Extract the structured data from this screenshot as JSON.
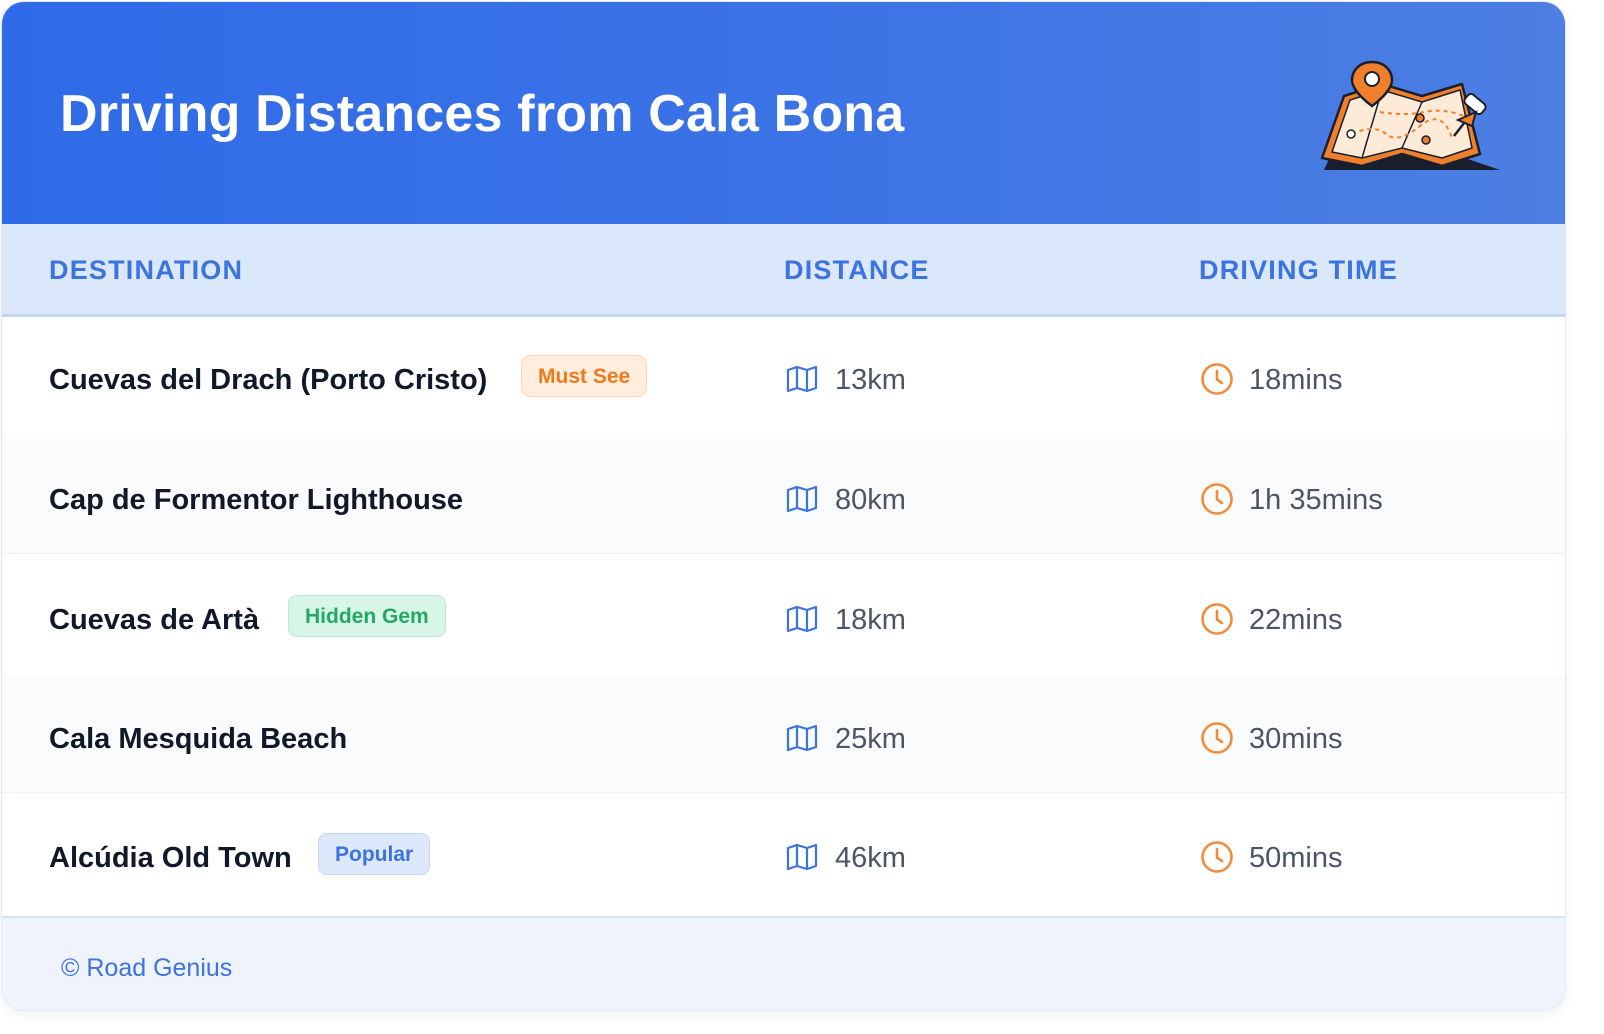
{
  "header": {
    "title": "Driving Distances from Cala Bona",
    "illustration": "map-with-pins-illustration"
  },
  "columns": {
    "destination": "DESTINATION",
    "distance": "DISTANCE",
    "driving_time": "DRIVING TIME"
  },
  "rows": [
    {
      "destination": "Cuevas del Drach (Porto Cristo)",
      "badge": "Must See",
      "badge_color": "#ef7a1a",
      "distance": "13km",
      "time": "18mins"
    },
    {
      "destination": "Cap de Formentor Lighthouse",
      "badge": "",
      "distance": "80km",
      "time": "1h 35mins"
    },
    {
      "destination": "Cuevas de Artà",
      "badge": "Hidden Gem",
      "badge_color": "#22a867",
      "distance": "18km",
      "time": "22mins"
    },
    {
      "destination": "Cala Mesquida Beach",
      "badge": "",
      "distance": "25km",
      "time": "30mins"
    },
    {
      "destination": "Alcúdia Old Town",
      "badge": "Popular",
      "badge_color": "#3b73e0",
      "distance": "46km",
      "time": "50mins"
    }
  ],
  "icons": {
    "distance": "map-icon",
    "time": "clock-icon"
  },
  "footer": {
    "copyright": "© Road Genius"
  },
  "colors": {
    "header_blue": "#2f6be8",
    "accent_blue": "#3b73e0",
    "clock_orange": "#f08c3c"
  }
}
